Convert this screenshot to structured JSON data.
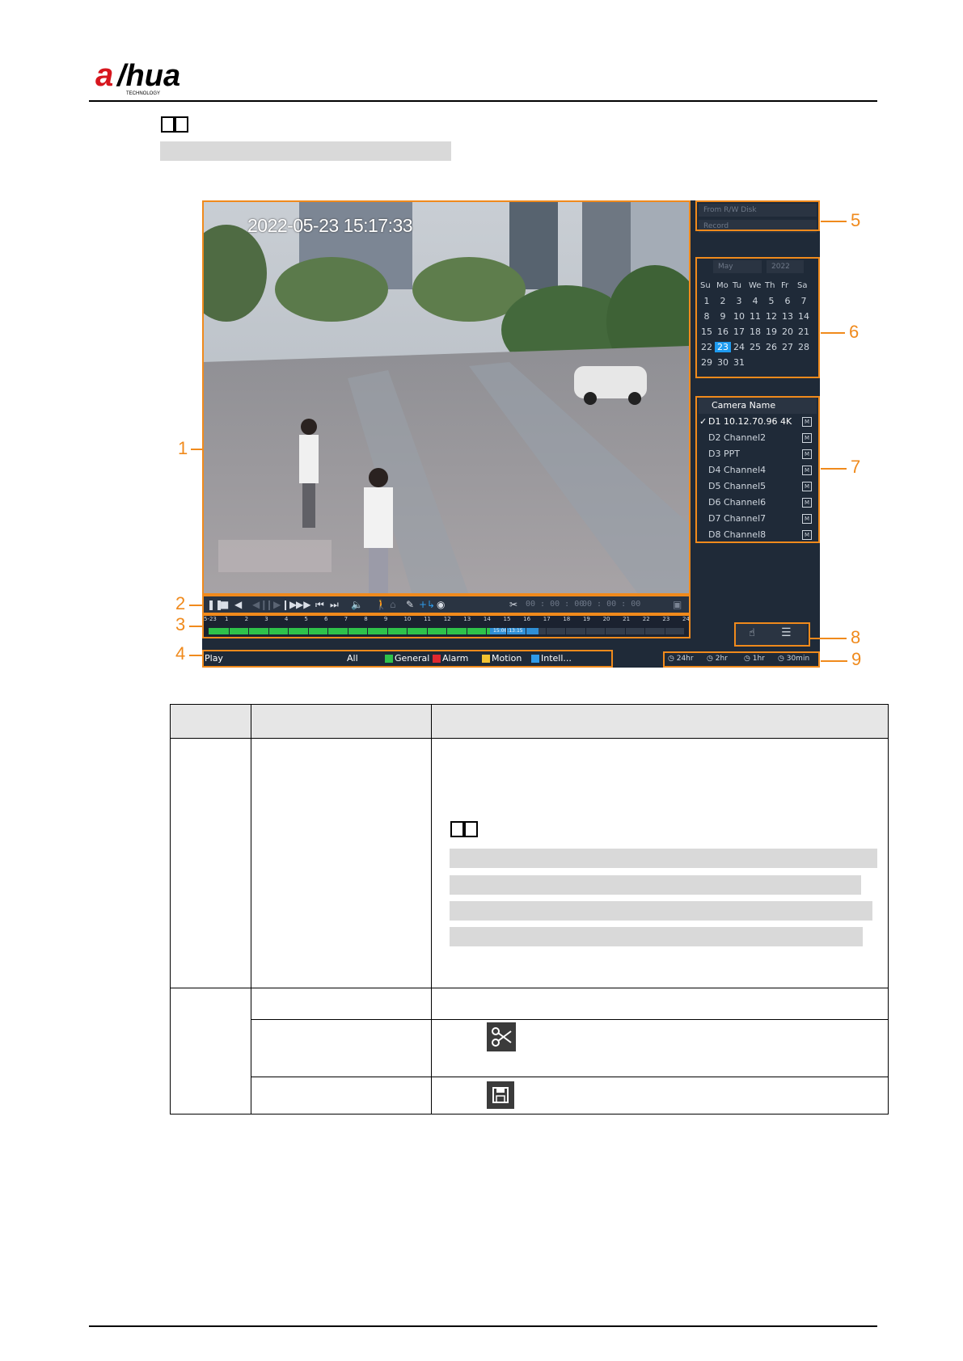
{
  "header": {
    "brand": "alhua",
    "brand_sub": "TECHNOLOGY"
  },
  "screenshot": {
    "video_timestamp": "2022-05-23 15:17:33",
    "source_dropdown": "From R/W Disk",
    "type_dropdown": "Record",
    "calendar": {
      "month": "May",
      "year": "2022",
      "weekdays": [
        "Su",
        "Mo",
        "Tu",
        "We",
        "Th",
        "Fr",
        "Sa"
      ],
      "weeks": [
        [
          "1",
          "2",
          "3",
          "4",
          "5",
          "6",
          "7"
        ],
        [
          "8",
          "9",
          "10",
          "11",
          "12",
          "13",
          "14"
        ],
        [
          "15",
          "16",
          "17",
          "18",
          "19",
          "20",
          "21"
        ],
        [
          "22",
          "23",
          "24",
          "25",
          "26",
          "27",
          "28"
        ],
        [
          "29",
          "30",
          "31",
          "",
          "",
          "",
          ""
        ]
      ],
      "selected_day": "23"
    },
    "camera_list": {
      "header": "Camera Name",
      "items": [
        {
          "label": "D1 10.12.70.96 4K",
          "checked": true,
          "badge": "M"
        },
        {
          "label": "D2 Channel2",
          "checked": false,
          "badge": "M"
        },
        {
          "label": "D3 PPT",
          "checked": false,
          "badge": "M"
        },
        {
          "label": "D4 Channel4",
          "checked": false,
          "badge": "M"
        },
        {
          "label": "D5 Channel5",
          "checked": false,
          "badge": "M"
        },
        {
          "label": "D6 Channel6",
          "checked": false,
          "badge": "M"
        },
        {
          "label": "D7 Channel7",
          "checked": false,
          "badge": "M"
        },
        {
          "label": "D8 Channel8",
          "checked": false,
          "badge": "M"
        }
      ]
    },
    "clip_start_time": "00 : 00 : 00",
    "clip_end_time": "00 : 00 : 00",
    "timeline": {
      "date_label": "5-23",
      "hours": [
        "1",
        "2",
        "3",
        "4",
        "5",
        "6",
        "7",
        "8",
        "9",
        "10",
        "11",
        "12",
        "13",
        "14",
        "15",
        "16",
        "17",
        "18",
        "19",
        "20",
        "21",
        "22",
        "23",
        "24"
      ],
      "marker_label": "15:06:13:15"
    },
    "play_mode": "Play",
    "record_types": [
      {
        "label": "All",
        "color": "#1f2a38"
      },
      {
        "label": "General",
        "color": "#2ec24a"
      },
      {
        "label": "Alarm",
        "color": "#e0282f"
      },
      {
        "label": "Motion",
        "color": "#f2c230"
      },
      {
        "label": "Intell...",
        "color": "#2f9ae8"
      }
    ],
    "time_spans": [
      "24hr",
      "2hr",
      "1hr",
      "30min"
    ]
  },
  "callouts": [
    "1",
    "2",
    "3",
    "4",
    "5",
    "6",
    "7",
    "8",
    "9"
  ],
  "colors": {
    "callout": "#f08a1c",
    "ui_background": "#1f2a38",
    "selected_day": "#1e9bf0"
  }
}
